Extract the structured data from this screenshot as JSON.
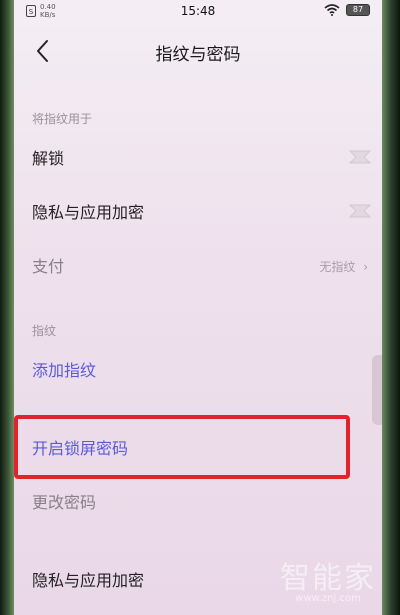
{
  "status_bar": {
    "sim_label": "S",
    "network": [
      "0.40",
      "KB/s"
    ],
    "time": "15:48",
    "battery": "87"
  },
  "header": {
    "title": "指纹与密码"
  },
  "sections": {
    "fingerprint_use": {
      "label": "将指纹用于",
      "items": [
        {
          "label": "解锁"
        },
        {
          "label": "隐私与应用加密"
        },
        {
          "label": "支付",
          "value": "无指纹"
        }
      ]
    },
    "fingerprint": {
      "label": "指纹",
      "add_label": "添加指纹"
    },
    "password": {
      "enable_label": "开启锁屏密码",
      "change_label": "更改密码",
      "privacy_label": "隐私与应用加密"
    }
  },
  "watermark": {
    "text": "智能家",
    "url": "www.znj.com"
  },
  "colors": {
    "accent": "#5a5ad8",
    "highlight": "#e3232b"
  }
}
